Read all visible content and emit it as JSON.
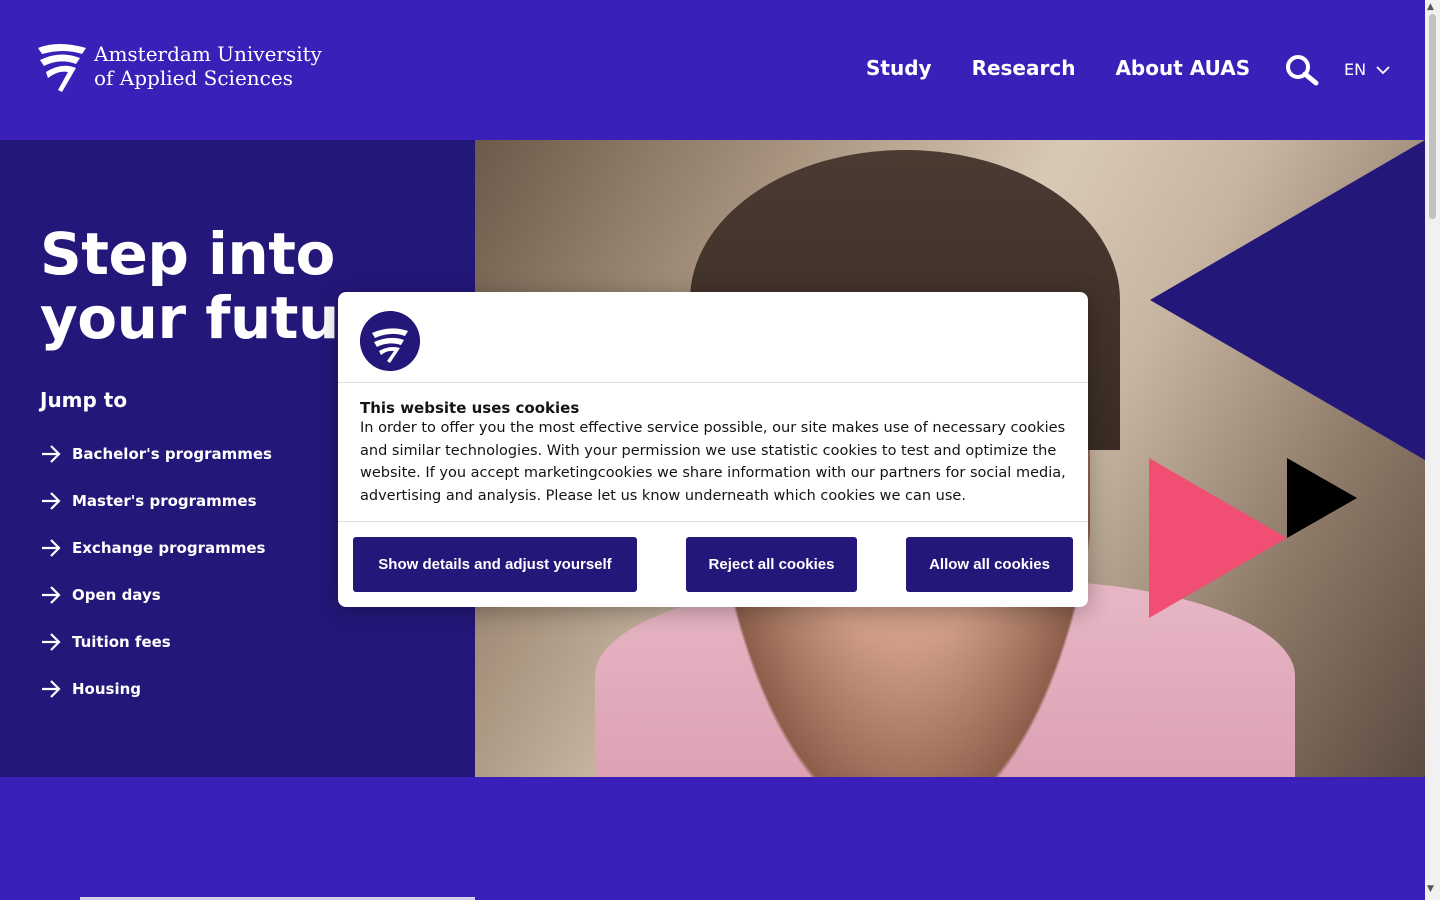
{
  "header": {
    "logo_line1": "Amsterdam University",
    "logo_line2": "of Applied Sciences",
    "nav": [
      "Study",
      "Research",
      "About AUAS"
    ],
    "language": "EN"
  },
  "hero": {
    "title_line1": "Step into",
    "title_line2": "your future",
    "jump_title": "Jump to",
    "jump_items": [
      "Bachelor's programmes",
      "Master's programmes",
      "Exchange programmes",
      "Open days",
      "Tuition fees",
      "Housing"
    ]
  },
  "cookie": {
    "title": "This website uses cookies",
    "text": "In order to offer you the most effective service possible, our site makes use of necessary cookies and similar technologies. With your permission we use statistic cookies to test and optimize the website. If you accept marketingcookies we share information with our partners for social media, advertising and analysis. Please let us know underneath which cookies we can use.",
    "btn_details": "Show details and adjust yourself",
    "btn_reject": "Reject all cookies",
    "btn_allow": "Allow all cookies"
  },
  "colors": {
    "primary": "#3a20b8",
    "dark": "#24177a",
    "pink": "#f04e72"
  }
}
